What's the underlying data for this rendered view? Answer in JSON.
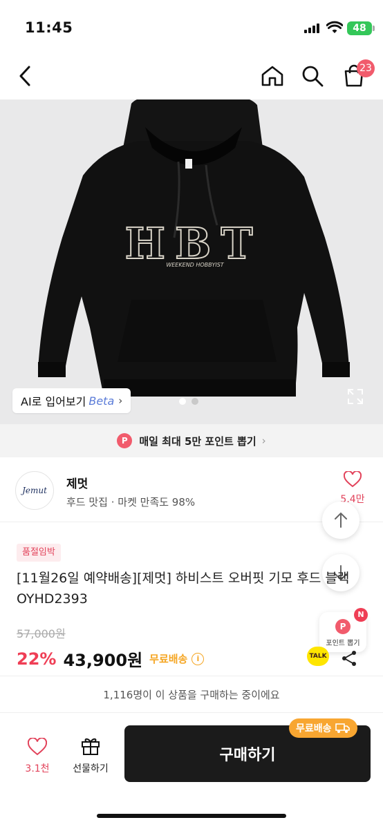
{
  "status": {
    "time": "11:45",
    "battery": "48"
  },
  "nav": {
    "cart_count": "23"
  },
  "hero": {
    "ai_label": "AI로 입어보기",
    "ai_beta": "Beta",
    "print_main": "HBT",
    "print_sub": "WEEKEND HOBBYIST",
    "slides": 2,
    "active_slide": 1
  },
  "points_banner": {
    "icon": "P",
    "text": "매일 최대 5만 포인트 뽑기"
  },
  "seller": {
    "logo_text": "Jemut",
    "name": "제멋",
    "subtitle": "후드 맛집 · 마켓 만족도 98%",
    "likes": "5.4만"
  },
  "product": {
    "tag": "품절임박",
    "title": "[11월26일 예약배송][제멋] 하비스트 오버핏 기모 후드 블랙 OYHD2393",
    "original_price": "57,000원",
    "discount": "22%",
    "price": "43,900원",
    "shipping": "무료배송"
  },
  "point_card": {
    "badge": "N",
    "icon": "P",
    "label": "포인트 뽑기"
  },
  "talk_label": "TALK",
  "buying_notice": "1,116명이 이 상품을 구매하는 중이에요",
  "bottom": {
    "wish_count": "3.1천",
    "gift_label": "선물하기",
    "buy_label": "구매하기",
    "ship_chip": "무료배송"
  },
  "colors": {
    "accent": "#ef3e55",
    "shipping": "#f5a623",
    "buy_button": "#1b1b1b"
  }
}
